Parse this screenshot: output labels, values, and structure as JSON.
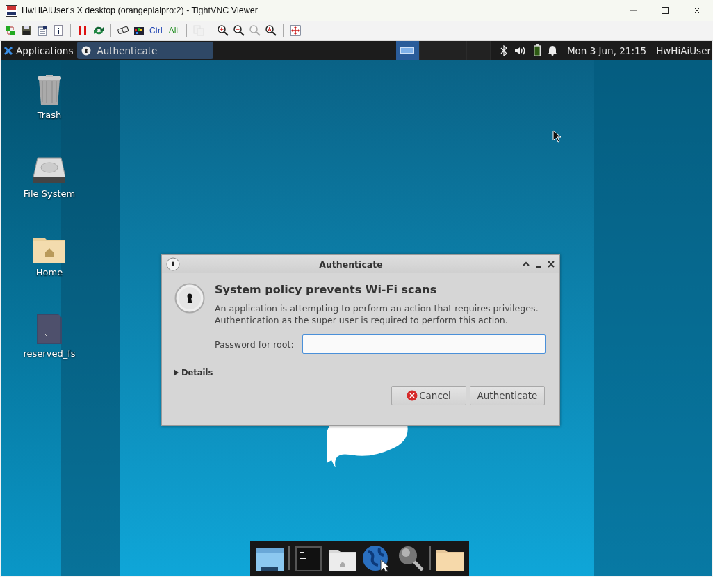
{
  "window": {
    "title": "HwHiAiUser's X desktop (orangepiaipro:2) - TightVNC Viewer"
  },
  "toolbar": [
    {
      "kind": "icon",
      "disabled": false
    },
    {
      "kind": "icon",
      "disabled": false
    },
    {
      "kind": "icon",
      "disabled": false
    },
    {
      "kind": "icon",
      "disabled": false
    },
    {
      "kind": "separator"
    },
    {
      "kind": "icon",
      "disabled": false
    },
    {
      "kind": "icon",
      "disabled": false
    },
    {
      "kind": "separator"
    },
    {
      "kind": "icon",
      "disabled": false
    },
    {
      "kind": "icon",
      "disabled": false
    },
    {
      "kind": "text",
      "label": "Ctrl",
      "color": "#1a3fb0"
    },
    {
      "kind": "text",
      "label": "Alt",
      "color": "#1a8a1a"
    },
    {
      "kind": "separator"
    },
    {
      "kind": "icon",
      "disabled": true
    },
    {
      "kind": "separator"
    },
    {
      "kind": "icon",
      "disabled": false
    },
    {
      "kind": "icon",
      "disabled": false
    },
    {
      "kind": "icon",
      "disabled": true
    },
    {
      "kind": "icon",
      "disabled": false
    },
    {
      "kind": "separator"
    },
    {
      "kind": "icon",
      "disabled": false
    }
  ],
  "panel": {
    "menu_label": "Applications",
    "tasks": [
      {
        "label": "Authenticate",
        "selected": true
      }
    ],
    "workspaces": [
      {
        "selected": true
      },
      {
        "selected": false
      },
      {
        "selected": false
      },
      {
        "selected": false
      }
    ],
    "clock": "Mon  3 Jun, 21:15",
    "user": "HwHiAiUser"
  },
  "desktop_icons": [
    {
      "label": "Trash"
    },
    {
      "label": "File System"
    },
    {
      "label": "Home"
    },
    {
      "label": "reserved_fs"
    }
  ],
  "dialog": {
    "title": "Authenticate",
    "heading": "System policy prevents Wi-Fi scans",
    "message": [
      "An application is attempting to perform an action that requires privileges.",
      "Authentication as the super user is required to perform this action."
    ],
    "password_label": "Password for root:",
    "password_focused": true,
    "details": {
      "label": "Details",
      "expanded": false
    },
    "buttons": [
      {
        "kind": "cancel",
        "label": "Cancel"
      },
      {
        "kind": "plain",
        "label": "Authenticate"
      }
    ]
  },
  "dock": [
    {
      "kind": "item"
    },
    {
      "kind": "separator"
    },
    {
      "kind": "item"
    },
    {
      "kind": "item"
    },
    {
      "kind": "item"
    },
    {
      "kind": "item"
    },
    {
      "kind": "separator"
    },
    {
      "kind": "item"
    }
  ]
}
